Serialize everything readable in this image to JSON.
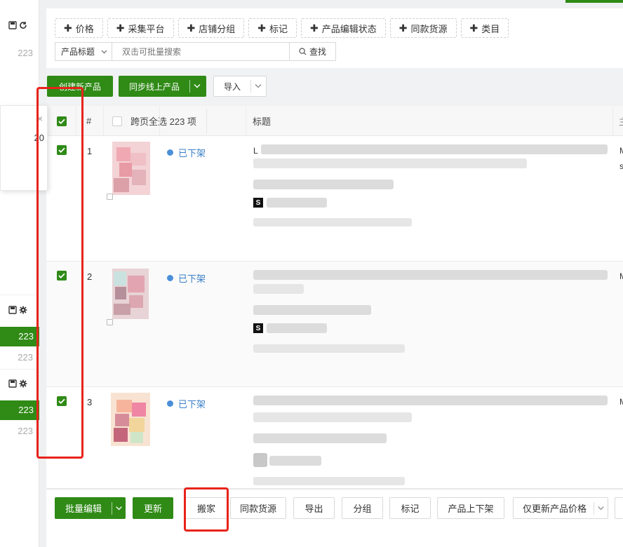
{
  "sidebar": {
    "group1": {
      "count": "223"
    },
    "group2": {
      "active_count": "223",
      "count": "223"
    },
    "group3": {
      "active_count": "223",
      "count": "223"
    }
  },
  "float_panel": {
    "close": "×",
    "number": "20"
  },
  "filters": [
    "价格",
    "采集平台",
    "店铺分组",
    "标记",
    "产品编辑状态",
    "同款货源",
    "类目"
  ],
  "search": {
    "field_label": "产品标题",
    "placeholder": "双击可批量搜索",
    "button": "查找"
  },
  "toolbar": {
    "create": "创建新产品",
    "sync": "同步线上产品",
    "import": "导入"
  },
  "table": {
    "headers": {
      "index": "#",
      "select_all": "跨页全选 223 项",
      "title": "标题",
      "next_col": "主"
    },
    "rows": [
      {
        "num": "1",
        "status": "已下架",
        "title_start": "L",
        "side_a": "M",
        "side_b": "s"
      },
      {
        "num": "2",
        "status": "已下架",
        "side_a": "M"
      },
      {
        "num": "3",
        "status": "已下架",
        "side_a": "M"
      }
    ]
  },
  "bottom": {
    "batch_edit": "批量编辑",
    "update": "更新",
    "move": "搬家",
    "same_source": "同款货源",
    "export": "导出",
    "group": "分组",
    "mark": "标记",
    "shelf": "产品上下架",
    "update_price": "仅更新产品价格"
  },
  "colors": {
    "primary": "#2f8a16",
    "status": "#3a7fc7",
    "annotation": "#e8231b"
  }
}
